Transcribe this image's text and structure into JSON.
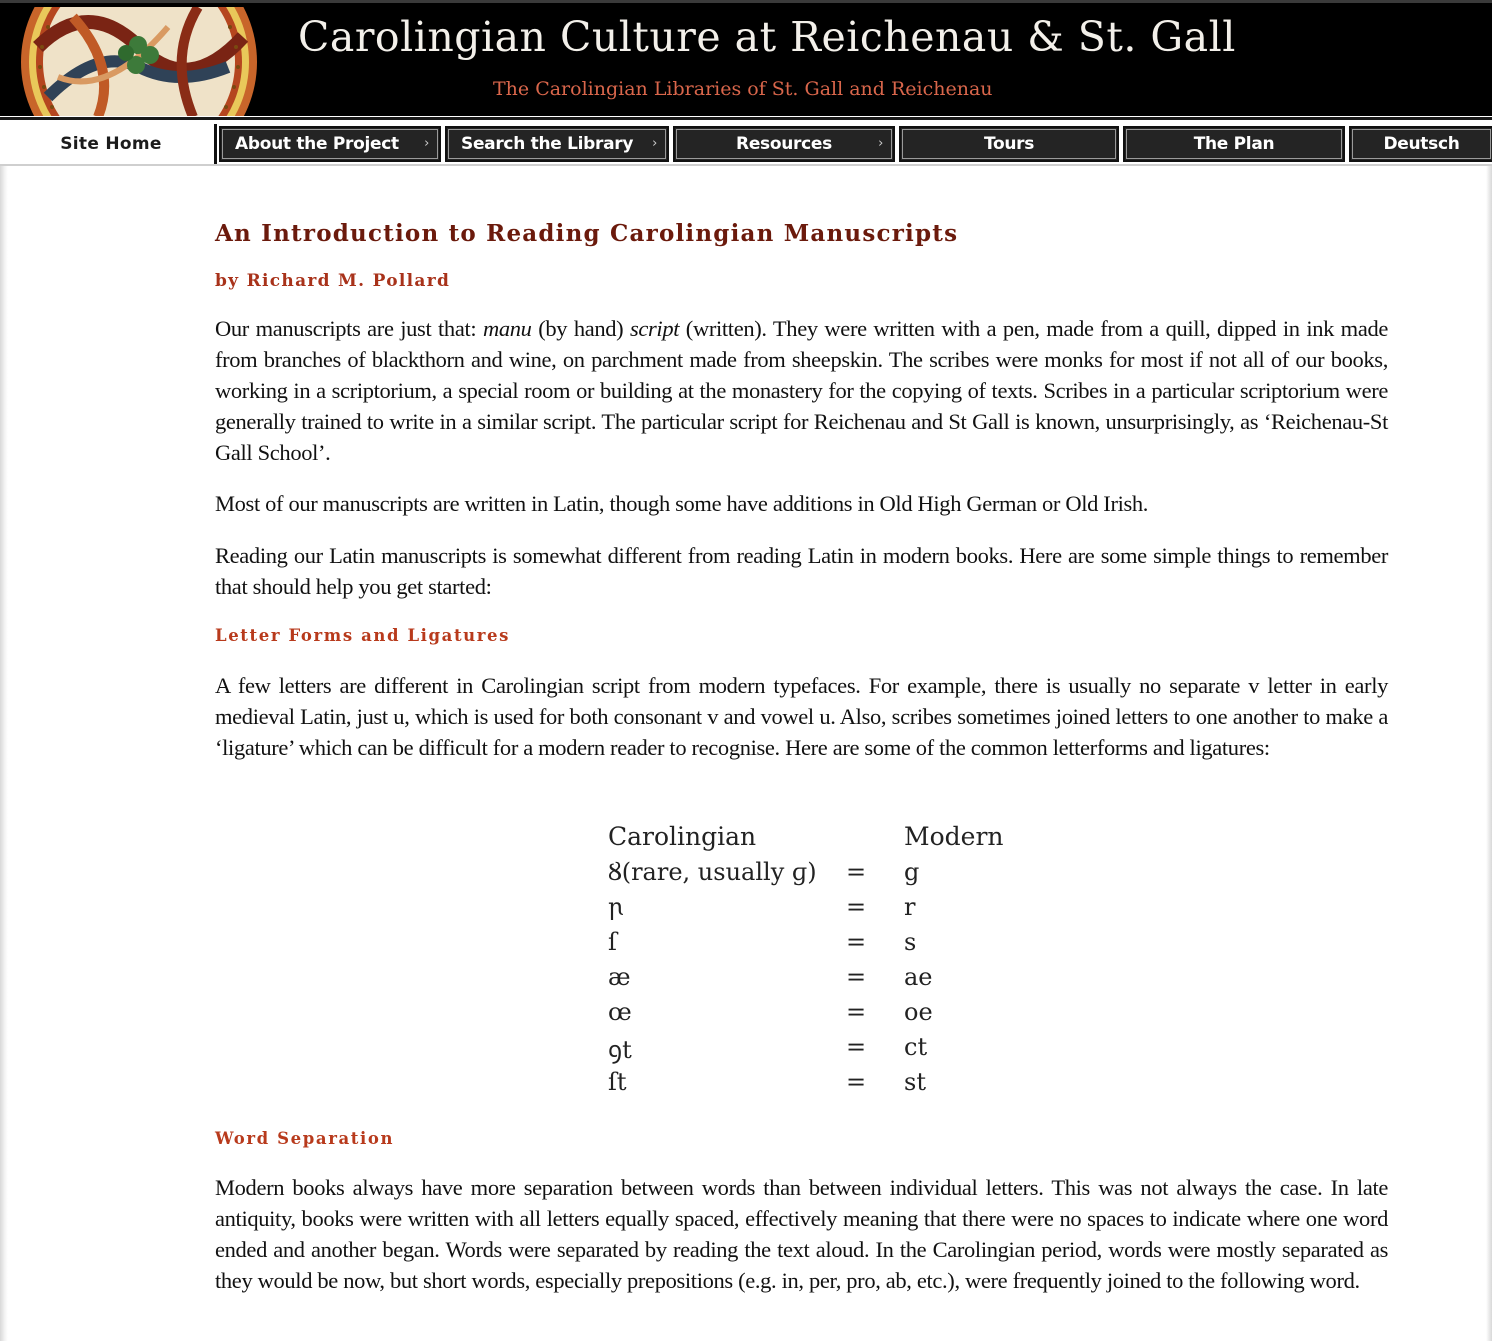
{
  "header": {
    "title": "Carolingian Culture at Reichenau & St. Gall",
    "subtitle": "The Carolingian Libraries of St. Gall and Reichenau",
    "logo_icon": "illuminated-roundel-logo"
  },
  "nav": {
    "items": [
      {
        "label": "Site Home",
        "has_submenu": false,
        "active": true
      },
      {
        "label": "About the Project",
        "has_submenu": true
      },
      {
        "label": "Search the Library",
        "has_submenu": true
      },
      {
        "label": "Resources",
        "has_submenu": true
      },
      {
        "label": "Tours",
        "has_submenu": false
      },
      {
        "label": "The Plan",
        "has_submenu": false
      },
      {
        "label": "Deutsch",
        "has_submenu": false
      }
    ],
    "submenu_arrow": "›"
  },
  "article": {
    "title": "An Introduction to Reading Carolingian Manuscripts",
    "byline": "by Richard M. Pollard",
    "intro": {
      "part1": "Our manuscripts are just that: ",
      "em1": "manu",
      "part2": " (by hand) ",
      "em2": "script",
      "part3": " (written). They were written with a pen, made from a quill, dipped in ink made from branches of blackthorn and wine, on parchment made from sheepskin. The scribes were monks for most if not all of our books, working in a scriptorium, a special room or building at the monastery for the copying of texts. Scribes in a particular scriptorium were generally trained to write in a similar script. The particular script for Reichenau and St Gall is known, unsurprisingly, as ‘Reichenau-St Gall School’."
    },
    "para2": "Most of our manuscripts are written in Latin, though some have additions in Old High German or Old Irish.",
    "para3": "Reading our Latin manuscripts is somewhat different from reading Latin in modern books. Here are some simple things to remember that should help you get started:",
    "sections": [
      {
        "heading": "Letter Forms and Ligatures",
        "body": "A few letters are different in Carolingian script from modern typefaces. For example, there is usually no separate v letter in early medieval Latin, just u, which is used for both consonant v and vowel u. Also, scribes sometimes joined letters to one another to make a ‘ligature’ which can be difficult for a modern reader to recognise. Here are some of the common letterforms and ligatures:"
      },
      {
        "heading": "Word Separation",
        "body": "Modern books always have more separation between words than between individual letters. This was not always the case. In late antiquity, books were written with all letters equally spaced, effectively meaning that there were no spaces to indicate where one word ended and another began. Words were separated by reading the text aloud. In the Carolingian period, words were mostly separated as they would be now, but short words, especially prepositions (e.g. in, per, pro, ab, etc.), were frequently joined to the following word."
      }
    ],
    "ligature_table": {
      "header": {
        "carolingian": "Carolingian",
        "modern": "Modern"
      },
      "equals": "=",
      "rows": [
        {
          "carolingian": "Ȣ(rare, usually ɡ)",
          "modern": "g"
        },
        {
          "carolingian": "ꞃ",
          "modern": "r"
        },
        {
          "carolingian": "ſ",
          "modern": "s"
        },
        {
          "carolingian": "æ",
          "modern": "ae"
        },
        {
          "carolingian": "œ",
          "modern": "oe"
        },
        {
          "carolingian": "ꝯt",
          "modern": "ct"
        },
        {
          "carolingian": "ſt",
          "modern": "st"
        }
      ]
    }
  },
  "colors": {
    "banner_bg": "#000000",
    "title_text": "#f3f0ea",
    "subtitle_text": "#d9664b",
    "nav_bg": "#242424",
    "article_title": "#6b1a0c",
    "section_heading": "#b83a1c",
    "body_text": "#111111"
  }
}
